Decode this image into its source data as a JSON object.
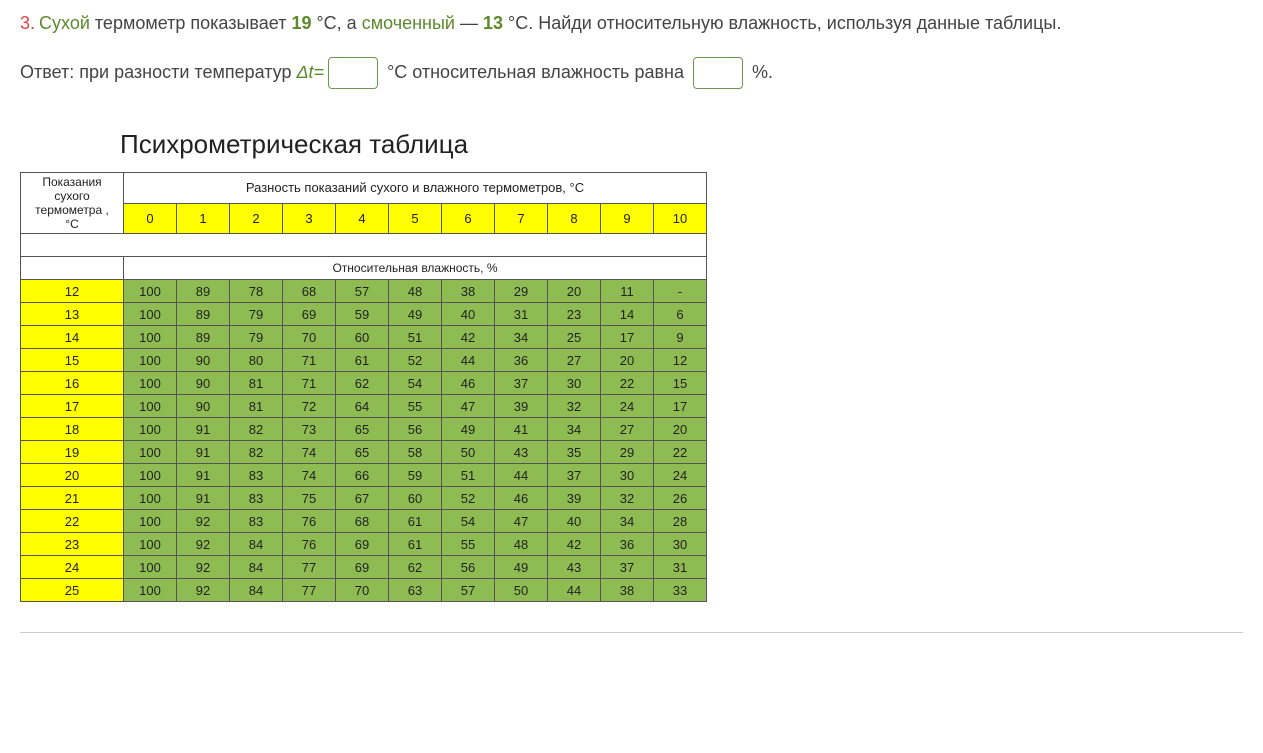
{
  "question": {
    "number": "3.",
    "word_dry": "Сухой",
    "text1": " термометр показывает ",
    "temp_dry": "19",
    "text2": " °C, а ",
    "word_wet": "смоченный",
    "text3": " — ",
    "temp_wet": "13",
    "text4": " °C. Найди относительную влажность, используя данные таблицы."
  },
  "answer": {
    "prefix": "Ответ: при разности температур ",
    "delta": "Δt=",
    "mid": " °C относительная влажность равна ",
    "suffix": " %."
  },
  "table": {
    "title": "Психрометрическая таблица",
    "row_header": "Показания сухого термометра , °C",
    "col_header": "Разность показаний сухого и влажного термометров, °C",
    "sub_header": "Относительная влажность, %",
    "cols": [
      "0",
      "1",
      "2",
      "3",
      "4",
      "5",
      "6",
      "7",
      "8",
      "9",
      "10"
    ],
    "rows": [
      {
        "t": "12",
        "v": [
          "100",
          "89",
          "78",
          "68",
          "57",
          "48",
          "38",
          "29",
          "20",
          "11",
          "-"
        ]
      },
      {
        "t": "13",
        "v": [
          "100",
          "89",
          "79",
          "69",
          "59",
          "49",
          "40",
          "31",
          "23",
          "14",
          "6"
        ]
      },
      {
        "t": "14",
        "v": [
          "100",
          "89",
          "79",
          "70",
          "60",
          "51",
          "42",
          "34",
          "25",
          "17",
          "9"
        ]
      },
      {
        "t": "15",
        "v": [
          "100",
          "90",
          "80",
          "71",
          "61",
          "52",
          "44",
          "36",
          "27",
          "20",
          "12"
        ]
      },
      {
        "t": "16",
        "v": [
          "100",
          "90",
          "81",
          "71",
          "62",
          "54",
          "46",
          "37",
          "30",
          "22",
          "15"
        ]
      },
      {
        "t": "17",
        "v": [
          "100",
          "90",
          "81",
          "72",
          "64",
          "55",
          "47",
          "39",
          "32",
          "24",
          "17"
        ]
      },
      {
        "t": "18",
        "v": [
          "100",
          "91",
          "82",
          "73",
          "65",
          "56",
          "49",
          "41",
          "34",
          "27",
          "20"
        ]
      },
      {
        "t": "19",
        "v": [
          "100",
          "91",
          "82",
          "74",
          "65",
          "58",
          "50",
          "43",
          "35",
          "29",
          "22"
        ]
      },
      {
        "t": "20",
        "v": [
          "100",
          "91",
          "83",
          "74",
          "66",
          "59",
          "51",
          "44",
          "37",
          "30",
          "24"
        ]
      },
      {
        "t": "21",
        "v": [
          "100",
          "91",
          "83",
          "75",
          "67",
          "60",
          "52",
          "46",
          "39",
          "32",
          "26"
        ]
      },
      {
        "t": "22",
        "v": [
          "100",
          "92",
          "83",
          "76",
          "68",
          "61",
          "54",
          "47",
          "40",
          "34",
          "28"
        ]
      },
      {
        "t": "23",
        "v": [
          "100",
          "92",
          "84",
          "76",
          "69",
          "61",
          "55",
          "48",
          "42",
          "36",
          "30"
        ]
      },
      {
        "t": "24",
        "v": [
          "100",
          "92",
          "84",
          "77",
          "69",
          "62",
          "56",
          "49",
          "43",
          "37",
          "31"
        ]
      },
      {
        "t": "25",
        "v": [
          "100",
          "92",
          "84",
          "77",
          "70",
          "63",
          "57",
          "50",
          "44",
          "38",
          "33"
        ]
      }
    ]
  },
  "chart_data": {
    "type": "table",
    "title": "Психрометрическая таблица",
    "xlabel": "Разность показаний сухого и влажного термометров, °C",
    "ylabel": "Показания сухого термометра, °C",
    "value_label": "Относительная влажность, %",
    "x": [
      0,
      1,
      2,
      3,
      4,
      5,
      6,
      7,
      8,
      9,
      10
    ],
    "y": [
      12,
      13,
      14,
      15,
      16,
      17,
      18,
      19,
      20,
      21,
      22,
      23,
      24,
      25
    ],
    "values": [
      [
        100,
        89,
        78,
        68,
        57,
        48,
        38,
        29,
        20,
        11,
        null
      ],
      [
        100,
        89,
        79,
        69,
        59,
        49,
        40,
        31,
        23,
        14,
        6
      ],
      [
        100,
        89,
        79,
        70,
        60,
        51,
        42,
        34,
        25,
        17,
        9
      ],
      [
        100,
        90,
        80,
        71,
        61,
        52,
        44,
        36,
        27,
        20,
        12
      ],
      [
        100,
        90,
        81,
        71,
        62,
        54,
        46,
        37,
        30,
        22,
        15
      ],
      [
        100,
        90,
        81,
        72,
        64,
        55,
        47,
        39,
        32,
        24,
        17
      ],
      [
        100,
        91,
        82,
        73,
        65,
        56,
        49,
        41,
        34,
        27,
        20
      ],
      [
        100,
        91,
        82,
        74,
        65,
        58,
        50,
        43,
        35,
        29,
        22
      ],
      [
        100,
        91,
        83,
        74,
        66,
        59,
        51,
        44,
        37,
        30,
        24
      ],
      [
        100,
        91,
        83,
        75,
        67,
        60,
        52,
        46,
        39,
        32,
        26
      ],
      [
        100,
        92,
        83,
        76,
        68,
        61,
        54,
        47,
        40,
        34,
        28
      ],
      [
        100,
        92,
        84,
        76,
        69,
        61,
        55,
        48,
        42,
        36,
        30
      ],
      [
        100,
        92,
        84,
        77,
        69,
        62,
        56,
        49,
        43,
        37,
        31
      ],
      [
        100,
        92,
        84,
        77,
        70,
        63,
        57,
        50,
        44,
        38,
        33
      ]
    ]
  }
}
